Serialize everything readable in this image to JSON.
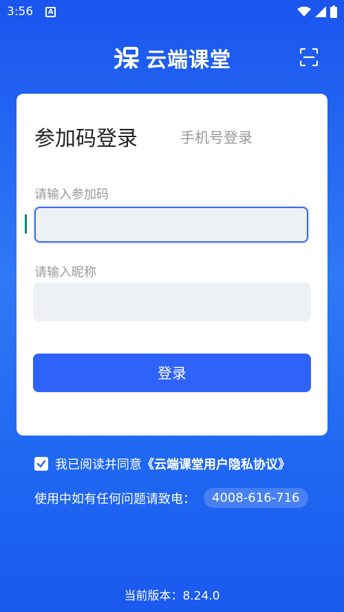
{
  "status_bar": {
    "time": "3:56",
    "a_badge": "A"
  },
  "header": {
    "app_name": "云端课堂"
  },
  "tabs": {
    "active": "参加码登录",
    "inactive": "手机号登录"
  },
  "form": {
    "code_label": "请输入参加码",
    "code_value": "",
    "nickname_label": "请输入昵称",
    "nickname_value": "",
    "login_button": "登录"
  },
  "agreement": {
    "checked": true,
    "text": "我已阅读并同意",
    "link": "《云端课堂用户隐私协议》"
  },
  "contact": {
    "text": "使用中如有任何问题请致电：",
    "phone": "4008-616-716"
  },
  "footer": {
    "version": "当前版本：8.24.0"
  },
  "colors": {
    "primary": "#2f62f6",
    "background": "#1f68f2",
    "input_bg": "#eef1f4"
  }
}
